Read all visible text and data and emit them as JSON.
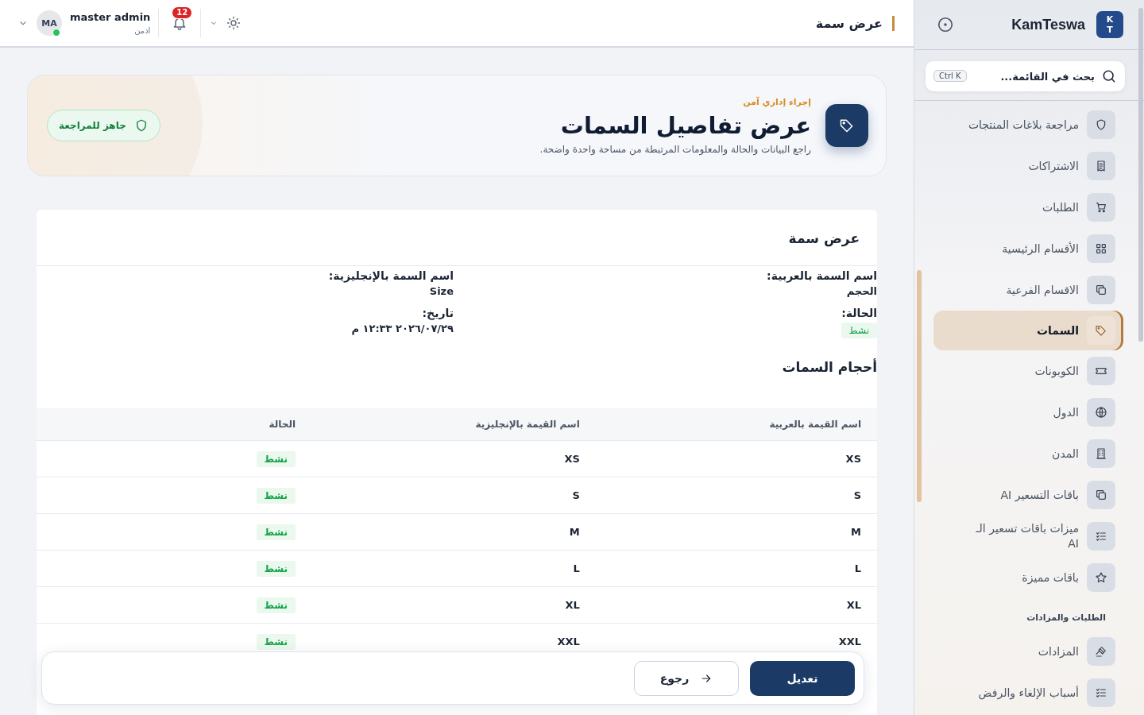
{
  "topbar": {
    "title": "عرض سمة",
    "notifications": "12",
    "user_name": "master admin",
    "user_role": "ادمن",
    "avatar": "MA",
    "online": true
  },
  "hero": {
    "eyebrow": "إجراء إداري آمن",
    "title": "عرض تفاصيل السمات",
    "description": "راجع البيانات والحالة والمعلومات المرتبطة من مساحة واحدة واضحة.",
    "badge": "جاهز للمراجعة"
  },
  "card": {
    "title": "عرض سمة",
    "fields": [
      {
        "label": "اسم السمة بالعربية:",
        "value": "الحجم",
        "kind": "text"
      },
      {
        "label": "اسم السمة بالإنجليزية:",
        "value": "Size",
        "kind": "text"
      },
      {
        "label": "الحالة:",
        "value": "نشط",
        "kind": "status"
      },
      {
        "label": "تاريخ:",
        "value": "٢٠٢٦/٠٧/٢٩ ١٢:٣٣ م",
        "kind": "text"
      }
    ],
    "section_title": "أحجام السمات",
    "table": {
      "columns": [
        "اسم القيمة بالعربية",
        "اسم القيمة بالإنجليزية",
        "الحالة"
      ],
      "rows": [
        {
          "name_ar": "XS",
          "name_en": "XS",
          "status": "نشط"
        },
        {
          "name_ar": "S",
          "name_en": "S",
          "status": "نشط"
        },
        {
          "name_ar": "M",
          "name_en": "M",
          "status": "نشط"
        },
        {
          "name_ar": "L",
          "name_en": "L",
          "status": "نشط"
        },
        {
          "name_ar": "XL",
          "name_en": "XL",
          "status": "نشط"
        },
        {
          "name_ar": "XXL",
          "name_en": "XXL",
          "status": "نشط"
        }
      ]
    }
  },
  "actions": {
    "primary": "تعديل",
    "back": "رجوع"
  },
  "sidebar": {
    "logo_letters": [
      "K",
      "T"
    ],
    "brand": "KamTeswa",
    "search_placeholder": "بحث في القائمة...",
    "shortcut": "Ctrl K",
    "items": [
      {
        "kind": "link",
        "label": "مراجعة بلاغات المنتجات",
        "selected": false
      },
      {
        "kind": "link",
        "label": "الاشتراكات",
        "selected": false
      },
      {
        "kind": "link",
        "label": "الطلبات",
        "selected": false
      },
      {
        "kind": "link",
        "label": "الأقسام الرئيسية",
        "selected": false
      },
      {
        "kind": "link",
        "label": "الاقسام الفرعية",
        "selected": false
      },
      {
        "kind": "link",
        "label": "السمات",
        "selected": true
      },
      {
        "kind": "link",
        "label": "الكوبونات",
        "selected": false
      },
      {
        "kind": "link",
        "label": "الدول",
        "selected": false
      },
      {
        "kind": "link",
        "label": "المدن",
        "selected": false
      },
      {
        "kind": "link",
        "label": "باقات التسعير AI",
        "selected": false
      },
      {
        "kind": "link",
        "label": "ميزات باقات تسعير الـ AI",
        "selected": false
      },
      {
        "kind": "link",
        "label": "باقات مميزة",
        "selected": false
      },
      {
        "kind": "header",
        "label": "الطلبات والمزادات"
      },
      {
        "kind": "link",
        "label": "المزادات",
        "selected": false
      },
      {
        "kind": "link",
        "label": "أسباب الإلغاء والرفض",
        "selected": false
      }
    ]
  }
}
